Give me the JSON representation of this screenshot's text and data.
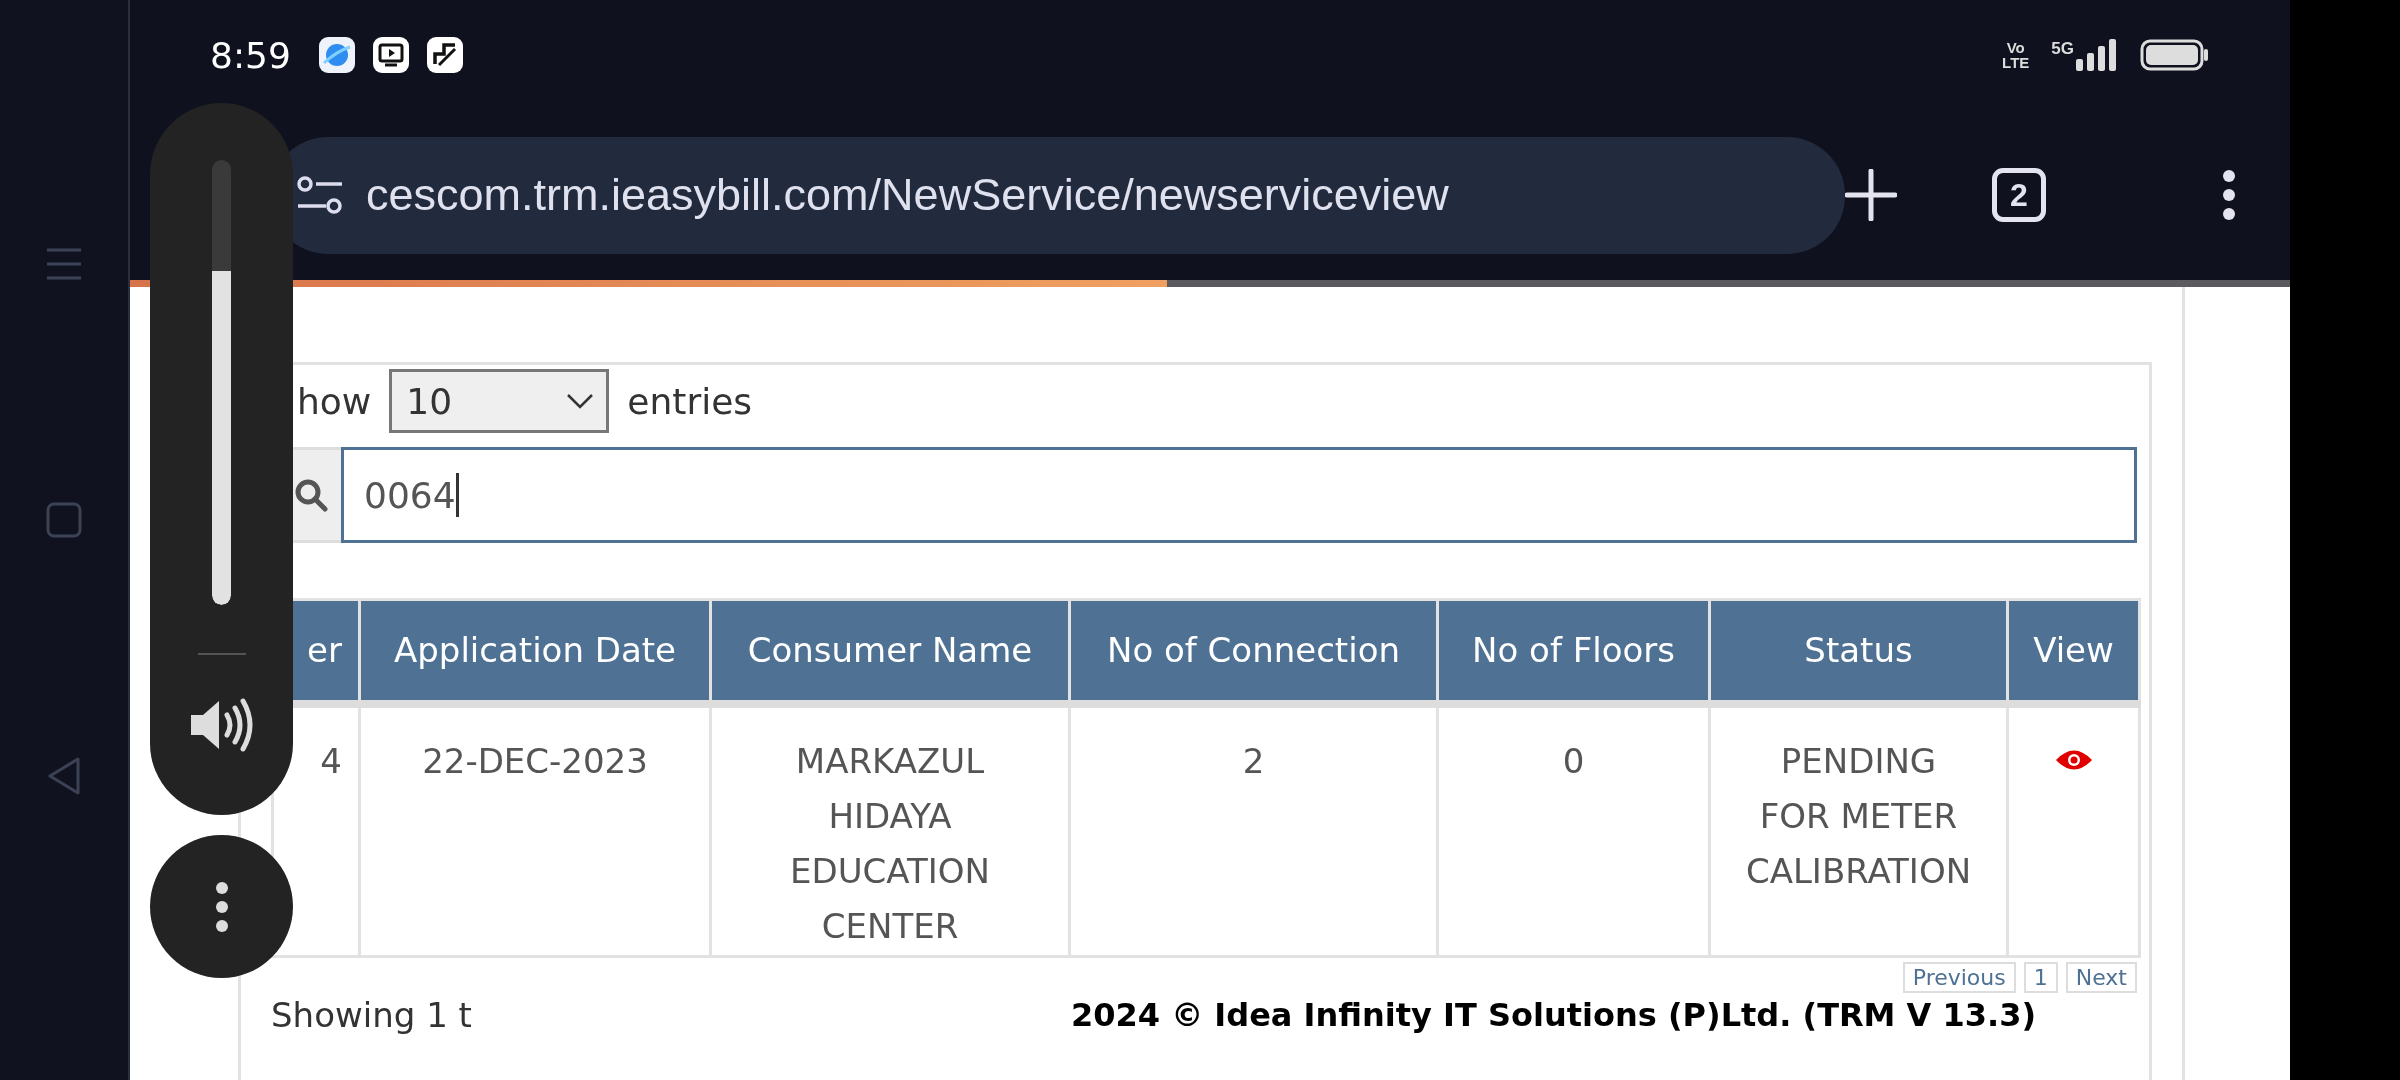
{
  "status_bar": {
    "time": "8:59",
    "volte": [
      "Vo",
      "LTE"
    ],
    "network": "5G"
  },
  "browser": {
    "url": "cescom.trm.ieasybill.com/NewService/newserviceview",
    "tab_count": "2",
    "load_progress": {
      "level": 0.48
    }
  },
  "volume_panel": {
    "level": 0.75
  },
  "length_control": {
    "label_before": "how",
    "value": "10",
    "label_after": "entries"
  },
  "search": {
    "value": "0064"
  },
  "table": {
    "columns": [
      "er",
      "Application Date",
      "Consumer Name",
      "No of Connection",
      "No of Floors",
      "Status",
      "View"
    ],
    "rows": [
      {
        "cells": [
          "4",
          "22-DEC-2023",
          "MARKAZUL\nHIDAYA\nEDUCATION\nCENTER",
          "2",
          "0",
          "PENDING\nFOR METER\nCALIBRATION"
        ]
      }
    ]
  },
  "pagination": [
    "Previous",
    "1",
    "Next"
  ],
  "info": "Showing 1 t",
  "footer": "2024 © Idea Infinity IT Solutions (P)Ltd. (TRM V 13.3)"
}
